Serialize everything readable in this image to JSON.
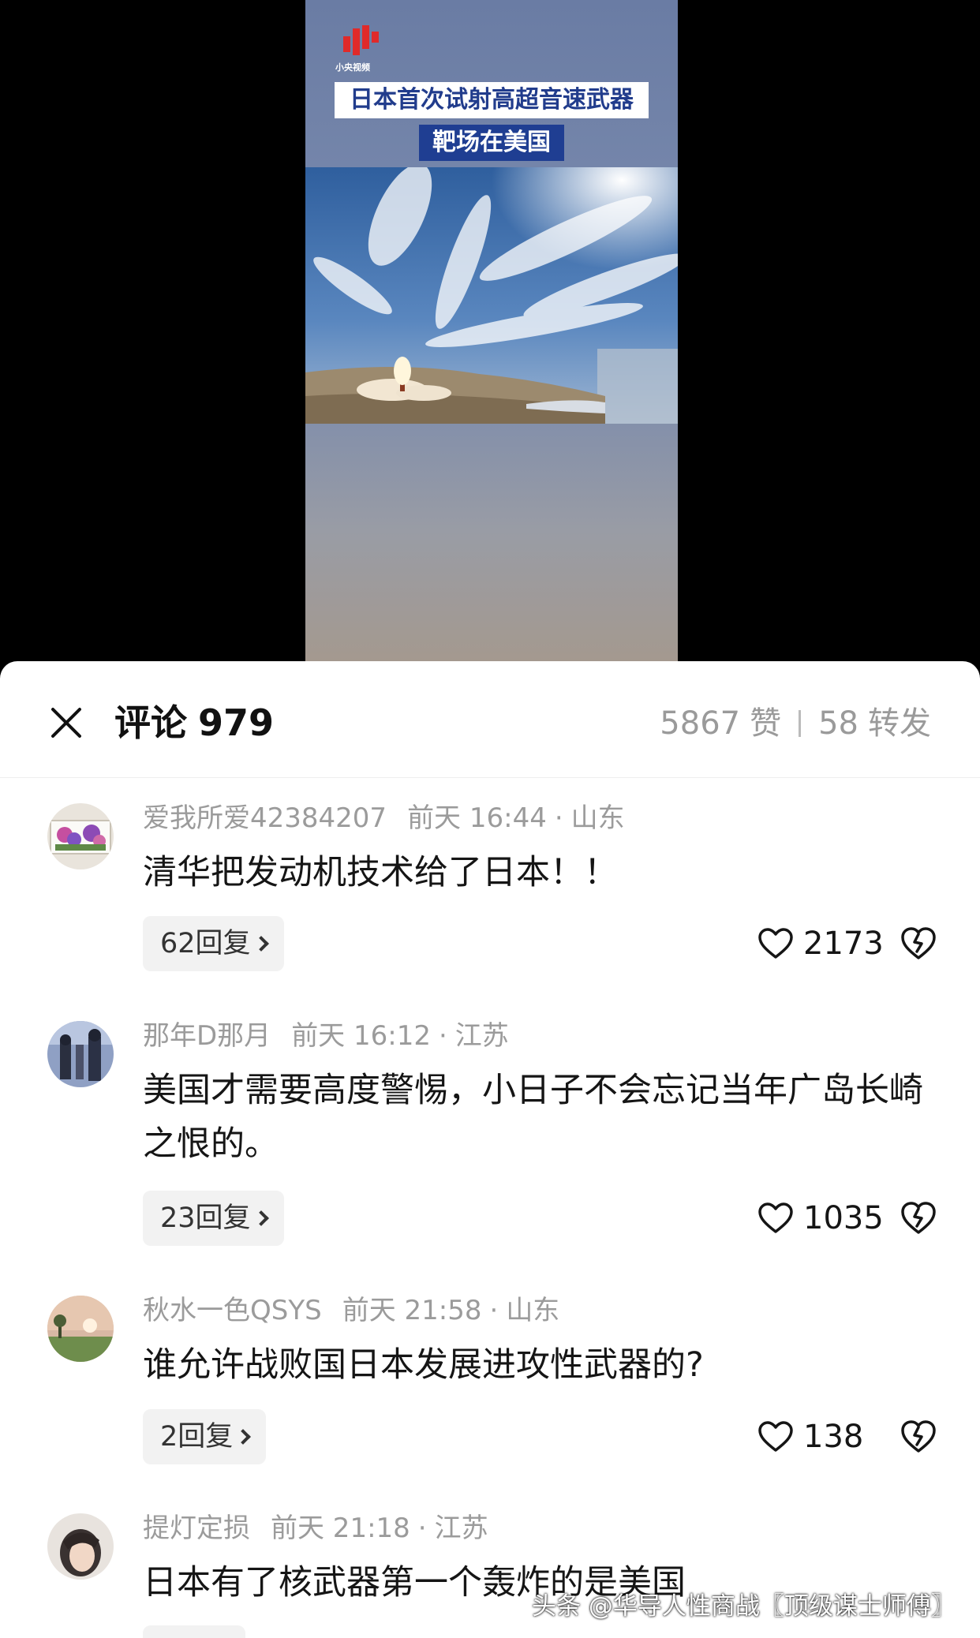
{
  "video": {
    "logo_text": "小央视频",
    "headline_line1": "日本首次试射高超音速武器",
    "headline_line2": "靶场在美国"
  },
  "header": {
    "title": "评论",
    "comment_count": "979",
    "likes": "5867",
    "likes_label": "赞",
    "shares": "58",
    "shares_label": "转发"
  },
  "comments": [
    {
      "username": "爱我所爱42384207",
      "time": "前天 16:44",
      "location": "山东",
      "text": "清华把发动机技术给了日本！！",
      "replies": "62回复",
      "likes": "2173"
    },
    {
      "username": "那年D那月",
      "time": "前天 16:12",
      "location": "江苏",
      "text": "美国才需要高度警惕，小日子不会忘记当年广岛长崎之恨的。",
      "replies": "23回复",
      "likes": "1035"
    },
    {
      "username": "秋水一色QSYS",
      "time": "前天 21:58",
      "location": "山东",
      "text": "谁允许战败国日本发展进攻性武器的?",
      "replies": "2回复",
      "likes": "138"
    },
    {
      "username": "提灯定损",
      "time": "前天 21:18",
      "location": "江苏",
      "text": "日本有了核武器第一个轰炸的是美国"
    }
  ],
  "watermark": "头条 @华导人性商战〖顶级谋士师傅〗",
  "colors": {
    "headline_blue": "#1f3e92",
    "text_primary": "#151515",
    "text_secondary": "#9b9b9b",
    "reply_bg": "#f2f2f2"
  }
}
